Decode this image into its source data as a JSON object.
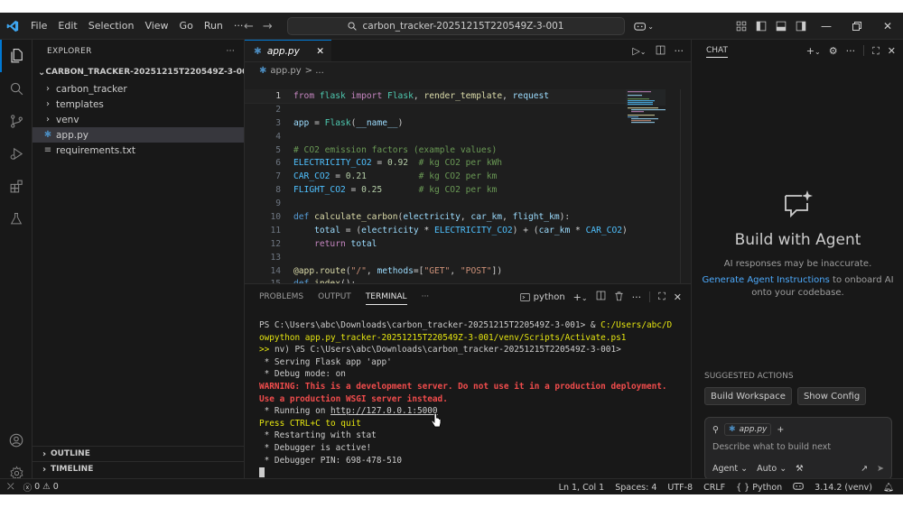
{
  "titlebar": {
    "menu": [
      "File",
      "Edit",
      "Selection",
      "View",
      "Go",
      "Run",
      "···"
    ],
    "search_text": "carbon_tracker-20251215T220549Z-3-001"
  },
  "sidebar": {
    "header": "EXPLORER",
    "more": "···",
    "root": "CARBON_TRACKER-20251215T220549Z-3-001",
    "items": [
      {
        "label": "carbon_tracker",
        "type": "folder"
      },
      {
        "label": "templates",
        "type": "folder"
      },
      {
        "label": "venv",
        "type": "folder"
      },
      {
        "label": "app.py",
        "type": "python",
        "selected": true
      },
      {
        "label": "requirements.txt",
        "type": "text"
      }
    ],
    "outline": "OUTLINE",
    "timeline": "TIMELINE"
  },
  "editor": {
    "tab": "app.py",
    "breadcrumb_file": "app.py",
    "breadcrumb_rest": "> ...",
    "line_numbers": [
      "1",
      "2",
      "3",
      "4",
      "5",
      "6",
      "7",
      "8",
      "9",
      "10",
      "11",
      "12",
      "13",
      "14",
      "15"
    ]
  },
  "panel": {
    "tabs": [
      "PROBLEMS",
      "OUTPUT",
      "TERMINAL",
      "···"
    ],
    "terminal_name": "python",
    "lines": [
      {
        "parts": [
          {
            "t": "PS C:\\Users\\abc\\Downloads\\carbon_tracker-20251215T220549Z-3-001> & ",
            "c": ""
          },
          {
            "t": "C:/Users/abc/D",
            "c": "t-yel"
          }
        ]
      },
      {
        "parts": [
          {
            "t": "owpython app.py_tracker-20251215T220549Z-3-001/venv/Scripts/Activate.ps1",
            "c": "t-yel"
          }
        ]
      },
      {
        "parts": [
          {
            "t": ">> ",
            "c": "t-yel"
          },
          {
            "t": "nv) PS C:\\Users\\abc\\Downloads\\carbon_tracker-20251215T220549Z-3-001>",
            "c": ""
          }
        ]
      },
      {
        "parts": [
          {
            "t": " * Serving Flask app 'app'",
            "c": ""
          }
        ]
      },
      {
        "parts": [
          {
            "t": " * Debug mode: on",
            "c": ""
          }
        ]
      },
      {
        "parts": [
          {
            "t": "WARNING: This is a development server. Do not use it in a production deployment.",
            "c": "t-red"
          }
        ]
      },
      {
        "parts": [
          {
            "t": "Use a production WSGI server instead.",
            "c": "t-red"
          }
        ]
      },
      {
        "parts": [
          {
            "t": " * Running on ",
            "c": ""
          },
          {
            "t": "http://127.0.0.1:5000",
            "c": "t-link"
          }
        ]
      },
      {
        "parts": [
          {
            "t": "Press CTRL+C to quit",
            "c": "t-yel"
          }
        ]
      },
      {
        "parts": [
          {
            "t": " * Restarting with stat",
            "c": ""
          }
        ]
      },
      {
        "parts": [
          {
            "t": " * Debugger is active!",
            "c": ""
          }
        ]
      },
      {
        "parts": [
          {
            "t": " * Debugger PIN: 698-478-510",
            "c": ""
          }
        ]
      }
    ]
  },
  "chat": {
    "tab": "CHAT",
    "hero_title": "Build with Agent",
    "hero_sub": "AI responses may be inaccurate.",
    "hero_link": "Generate Agent Instructions",
    "hero_link_rest": " to onboard AI",
    "hero_link_rest2": "onto your codebase.",
    "suggested_header": "SUGGESTED ACTIONS",
    "suggested": [
      "Build Workspace",
      "Show Config"
    ],
    "input_chip": "app.py",
    "input_placeholder": "Describe what to build next",
    "mode": "Agent",
    "model": "Auto"
  },
  "statusbar": {
    "errors": "0",
    "warnings": "0",
    "position": "Ln 1, Col 1",
    "spaces": "Spaces: 4",
    "encoding": "UTF-8",
    "eol": "CRLF",
    "language": "{ } Python",
    "interpreter": "3.14.2 (venv)"
  },
  "colors": {
    "accent": "#0078d4",
    "link": "#4daafc",
    "terminal_yellow": "#e5e510",
    "terminal_red": "#f14c4c"
  }
}
